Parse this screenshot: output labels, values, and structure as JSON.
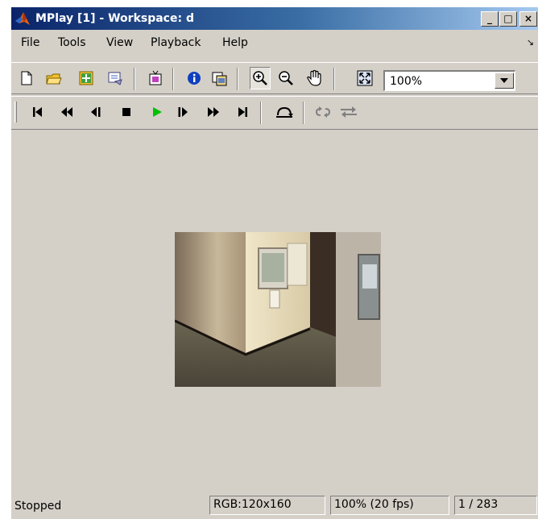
{
  "window": {
    "title": "MPlay [1] - Workspace: d",
    "controls": {
      "minimize": "_",
      "maximize": "□",
      "close": "×"
    }
  },
  "menu": {
    "items": [
      {
        "label": "File"
      },
      {
        "label": "Tools"
      },
      {
        "label": "View"
      },
      {
        "label": "Playback"
      },
      {
        "label": "Help"
      }
    ]
  },
  "toolbar": {
    "buttons": [
      "new-file-icon",
      "open-folder-icon",
      "import-icon",
      "export-icon",
      "connect-source-icon",
      "info-icon",
      "copy-frame-icon",
      "zoom-in-icon",
      "zoom-out-icon",
      "pan-hand-icon",
      "fit-to-window-icon"
    ],
    "zoom": {
      "value": "100%"
    }
  },
  "playback": {
    "buttons": [
      "go-to-start-icon",
      "rewind-icon",
      "step-back-icon",
      "stop-icon",
      "play-icon",
      "step-forward-icon",
      "fast-forward-icon",
      "go-to-end-icon",
      "jump-to-icon",
      "loop-icon",
      "autoreverse-icon"
    ],
    "play_color": "#00c000"
  },
  "viewer": {
    "background": "#d4d0c8",
    "content": "video-frame"
  },
  "status": {
    "state": "Stopped",
    "format": "RGB:120x160",
    "zoom_rate": "100% (20 fps)",
    "frame": "1 / 283"
  }
}
